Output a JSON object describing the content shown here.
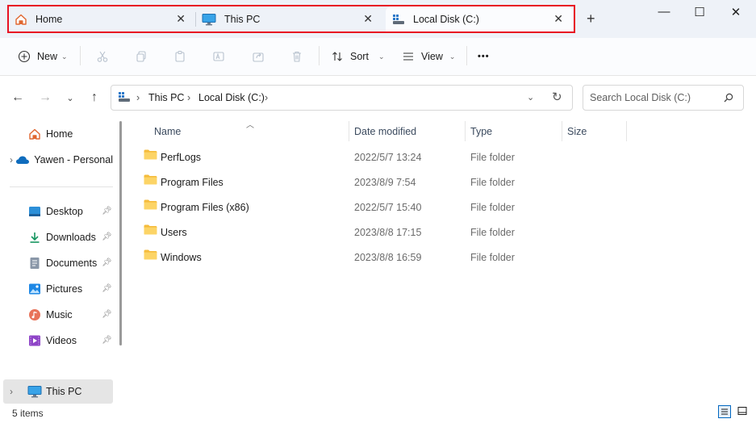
{
  "tabs": [
    {
      "label": "Home",
      "icon": "home-icon"
    },
    {
      "label": "This PC",
      "icon": "monitor-icon"
    },
    {
      "label": "Local Disk (C:)",
      "icon": "drive-icon"
    }
  ],
  "new_tab_symbol": "+",
  "window_controls": {
    "minimize": "—",
    "maximize": "☐",
    "close": "✕"
  },
  "toolbar": {
    "new_label": "New",
    "sort_label": "Sort",
    "view_label": "View",
    "more": "•••"
  },
  "breadcrumb": [
    "This PC",
    "Local Disk (C:)"
  ],
  "search": {
    "placeholder": "Search Local Disk (C:)"
  },
  "sidebar": {
    "top": [
      {
        "label": "Home"
      },
      {
        "label": "Yawen - Personal"
      }
    ],
    "quick": [
      {
        "label": "Desktop"
      },
      {
        "label": "Downloads"
      },
      {
        "label": "Documents"
      },
      {
        "label": "Pictures"
      },
      {
        "label": "Music"
      },
      {
        "label": "Videos"
      }
    ],
    "this_pc": "This PC"
  },
  "columns": {
    "name": "Name",
    "date": "Date modified",
    "type": "Type",
    "size": "Size"
  },
  "files": [
    {
      "name": "PerfLogs",
      "date": "2022/5/7 13:24",
      "type": "File folder"
    },
    {
      "name": "Program Files",
      "date": "2023/8/9 7:54",
      "type": "File folder"
    },
    {
      "name": "Program Files (x86)",
      "date": "2022/5/7 15:40",
      "type": "File folder"
    },
    {
      "name": "Users",
      "date": "2023/8/8 17:15",
      "type": "File folder"
    },
    {
      "name": "Windows",
      "date": "2023/8/8 16:59",
      "type": "File folder"
    }
  ],
  "status": {
    "count": "5 items"
  },
  "colors": {
    "highlight_outline": "#e81123",
    "accent": "#0067c0",
    "folder": "#f8c44a"
  }
}
